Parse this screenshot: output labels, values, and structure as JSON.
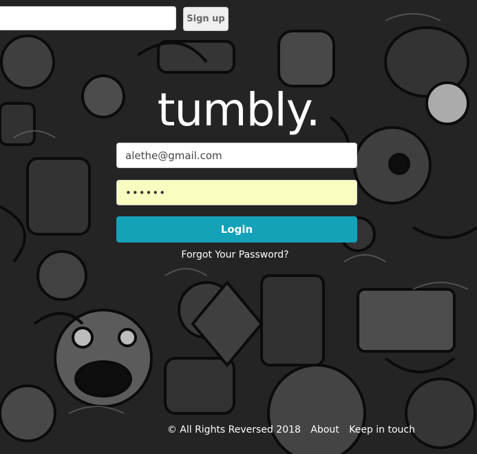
{
  "top_bar": {
    "input_value": "",
    "signup_label": "Sign up"
  },
  "logo": {
    "text": "tumbly."
  },
  "login_form": {
    "email_value": "alethe@gmail.com",
    "password_display": "••••••",
    "login_label": "Login",
    "forgot_label": "Forgot Your Password?"
  },
  "footer": {
    "copyright": "© All Rights Reversed 2018",
    "about": "About",
    "contact": "Keep in touch"
  },
  "colors": {
    "login_button": "#14a2b8",
    "password_autofill": "#fafdc0",
    "background": "#2a2a2a"
  }
}
